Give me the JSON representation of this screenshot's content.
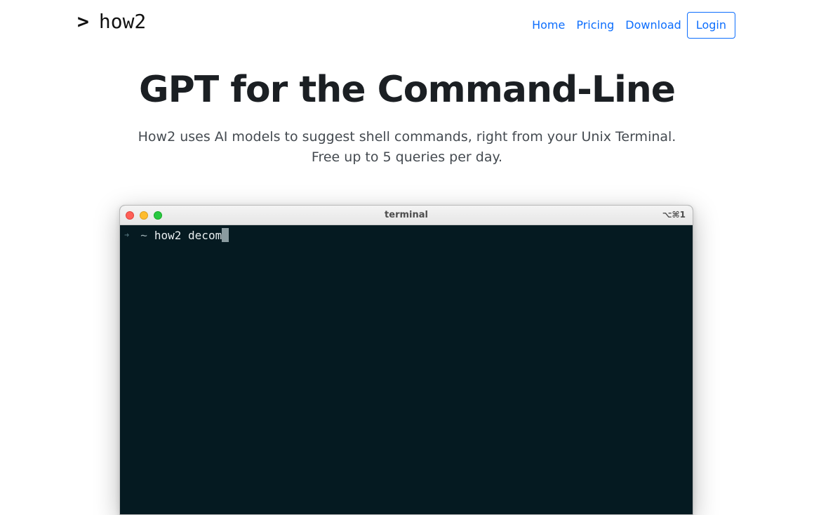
{
  "brand": {
    "prompt_glyph": ">",
    "name": "how2"
  },
  "nav": {
    "items": [
      {
        "label": "Home"
      },
      {
        "label": "Pricing"
      },
      {
        "label": "Download"
      }
    ],
    "login_label": "Login"
  },
  "hero": {
    "title": "GPT for the Command-Line",
    "subtitle_line1": "How2 uses AI models to suggest shell commands, right from your Unix Terminal.",
    "subtitle_line2": "Free up to 5 queries per day."
  },
  "terminal": {
    "title": "terminal",
    "shortcut": "⌥⌘1",
    "prompt_arrow": "➜",
    "prompt_dir": "~",
    "command": "how2 decom"
  },
  "colors": {
    "accent": "#0d6efd",
    "terminal_bg": "#051a21",
    "title_text": "#1b1f23"
  }
}
